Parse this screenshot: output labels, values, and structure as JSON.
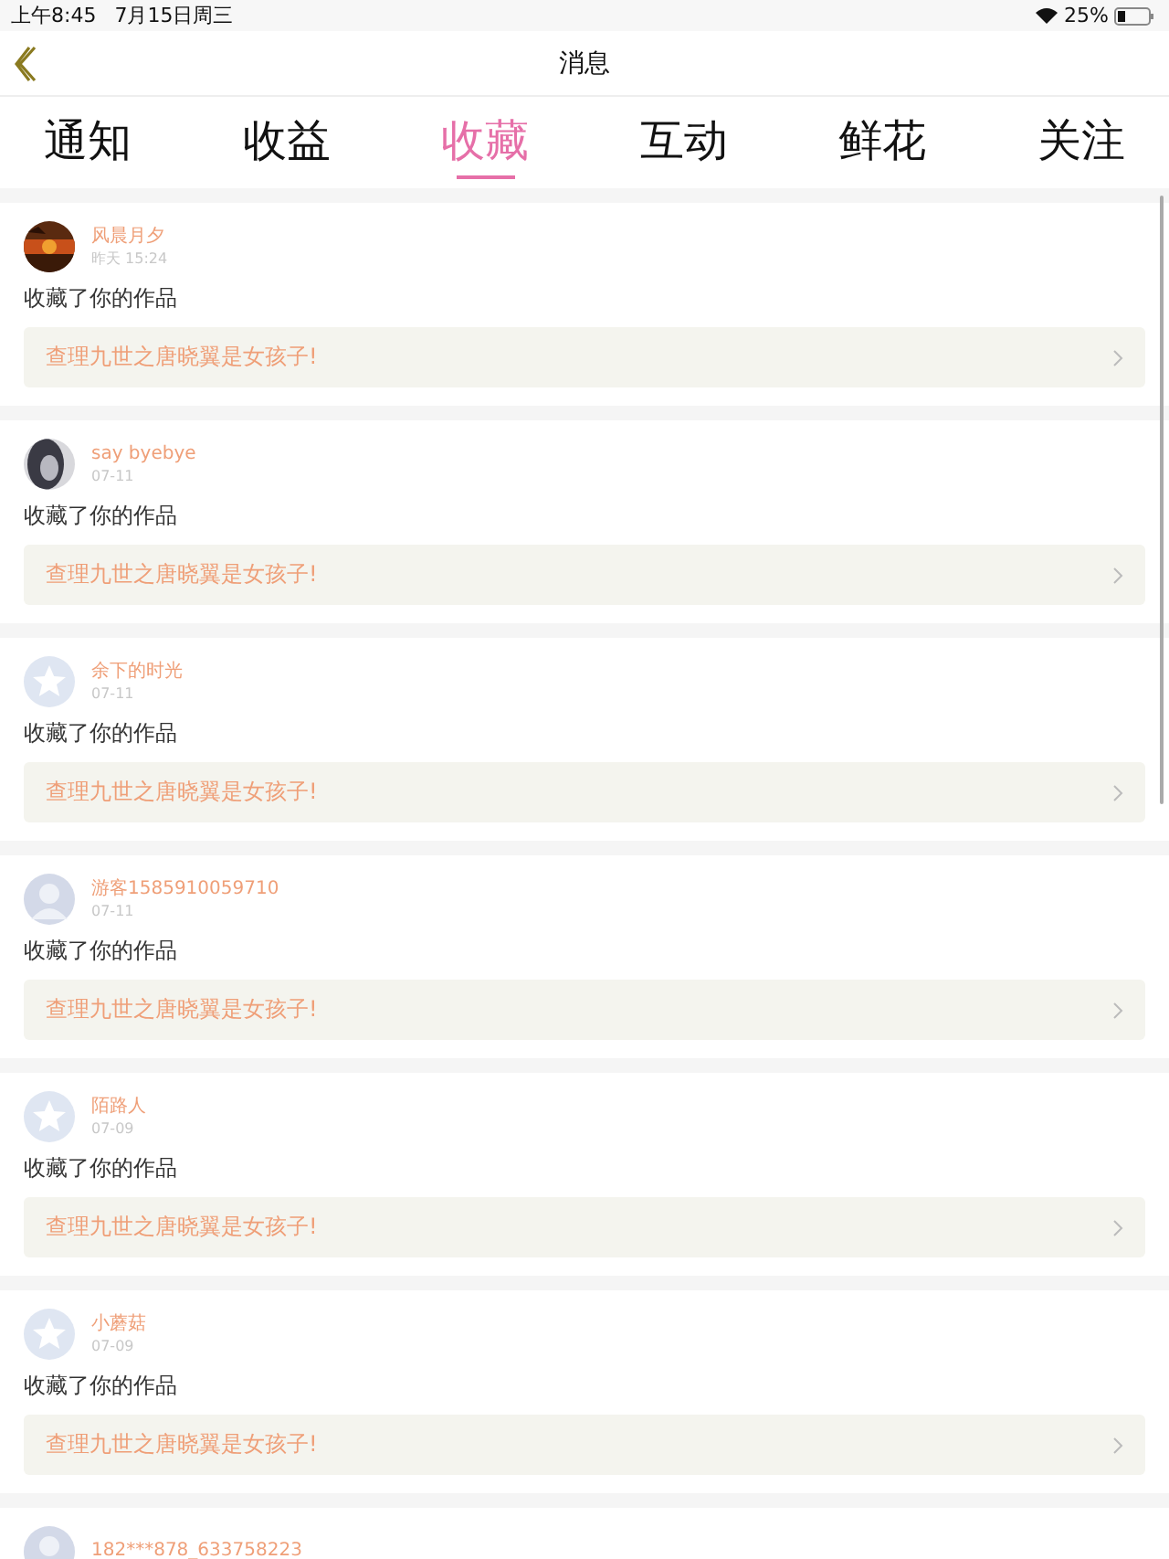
{
  "status_bar": {
    "time": "上午8:45",
    "date": "7月15日周三",
    "battery": "25%"
  },
  "nav": {
    "title": "消息"
  },
  "tabs": [
    {
      "label": "通知",
      "selected": false
    },
    {
      "label": "收益",
      "selected": false
    },
    {
      "label": "收藏",
      "selected": true
    },
    {
      "label": "互动",
      "selected": false
    },
    {
      "label": "鲜花",
      "selected": false
    },
    {
      "label": "关注",
      "selected": false
    }
  ],
  "items": [
    {
      "name": "风晨月夕",
      "time": "昨天 15:24",
      "action": "收藏了你的作品",
      "work": "查理九世之唐晓翼是女孩子!"
    },
    {
      "name": "say byebye",
      "time": "07-11",
      "action": "收藏了你的作品",
      "work": "查理九世之唐晓翼是女孩子!"
    },
    {
      "avatar": {
        "kind": "star"
      },
      "name": "余下的时光",
      "time": "07-11",
      "action": "收藏了你的作品",
      "work": "查理九世之唐晓翼是女孩子!"
    },
    {
      "avatar": {
        "kind": "person"
      },
      "name": "游客1585910059710",
      "time": "07-11",
      "action": "收藏了你的作品",
      "work": "查理九世之唐晓翼是女孩子!"
    },
    {
      "avatar": {
        "kind": "star"
      },
      "name": "陌路人",
      "time": "07-09",
      "action": "收藏了你的作品",
      "work": "查理九世之唐晓翼是女孩子!"
    },
    {
      "avatar": {
        "kind": "star"
      },
      "name": "小蘑菇",
      "time": "07-09",
      "action": "收藏了你的作品",
      "work": "查理九世之唐晓翼是女孩子!"
    },
    {
      "avatar": {
        "kind": "person"
      },
      "name": "182***878_633758223"
    }
  ]
}
